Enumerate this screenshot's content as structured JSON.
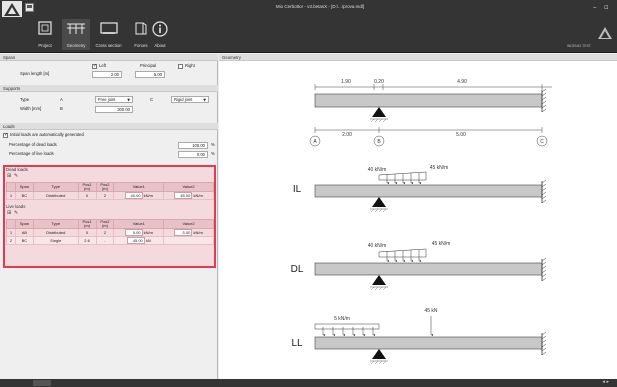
{
  "window": {
    "title": "Mio Cerbottor - v3.betasX - [D:\\...\\prova.mdl]"
  },
  "ribbon": {
    "tabs": [
      {
        "label": "Project"
      },
      {
        "label": "Geometry"
      },
      {
        "label": "Cross section"
      },
      {
        "label": "Forces"
      },
      {
        "label": "About"
      }
    ],
    "brand": "INGENIO-TEST"
  },
  "spans": {
    "title": "Spans",
    "left_label": "Left",
    "principal_label": "Principal",
    "right_label": "Right",
    "length_label": "Span length [m]",
    "left_value": "2.00",
    "principal_value": "5.00"
  },
  "supports": {
    "title": "Supports",
    "type_label": "Type",
    "a_label": "A",
    "a_value": "Free joint",
    "c_label": "C",
    "c_value": "Rigid joint",
    "width_label": "Width [mm]",
    "b_label": "B",
    "width_value": "300.00"
  },
  "loads": {
    "title": "Loads",
    "auto_label": "Initial loads are automatically generated",
    "dead_pct_label": "Percentage of dead loads",
    "dead_pct_value": "100.00",
    "dead_pct_unit": "%",
    "live_pct_label": "Percentage of live loads",
    "live_pct_value": "0.00",
    "live_pct_unit": "%"
  },
  "dead_loads": {
    "title": "Dead loads",
    "headers": [
      "",
      "Span",
      "Type",
      "Pos1 (m)",
      "Pos2 (m)",
      "Value1",
      "Value2"
    ],
    "rows": [
      {
        "idx": "1",
        "span": "BC",
        "type": "Distributed",
        "pos1": "0",
        "pos2": "2",
        "v1": "40.00",
        "u1": "kN/m",
        "v2": "45.00",
        "u2": "kN/m"
      }
    ]
  },
  "live_loads": {
    "title": "Live loads",
    "headers": [
      "",
      "Span",
      "Type",
      "Pos1 (m)",
      "Pos2 (m)",
      "Value1",
      "Value2"
    ],
    "rows": [
      {
        "idx": "1",
        "span": "AB",
        "type": "Distributed",
        "pos1": "0",
        "pos2": "2",
        "v1": "5.00",
        "u1": "kN/m",
        "v2": "5.00",
        "u2": "kN/m"
      },
      {
        "idx": "2",
        "span": "BC",
        "type": "Single",
        "pos1": "2.6",
        "pos2": "-",
        "v1": "45.00",
        "u1": "kN",
        "v2": "",
        "u2": ""
      }
    ]
  },
  "geometry": {
    "title": "Geometry",
    "top_dims": [
      "1.90",
      "0.20",
      "4.90"
    ],
    "bottom_dims": [
      "2.00",
      "5.00"
    ],
    "nodes": [
      "A",
      "B",
      "C"
    ],
    "diagrams": [
      {
        "label": "IL",
        "loads": [
          "40 kN/m",
          "45 kN/m"
        ]
      },
      {
        "label": "DL",
        "loads": [
          "40 kN/m",
          "45 kN/m"
        ]
      },
      {
        "label": "LL",
        "loads": [
          "5 kN/m",
          "45 kN"
        ]
      }
    ]
  },
  "colors": {
    "accent": "#e33b56",
    "chrome": "#343434",
    "beam": "#c8c8c8"
  }
}
